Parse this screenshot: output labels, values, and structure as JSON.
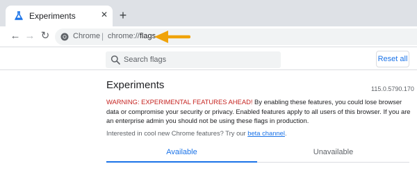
{
  "browser": {
    "tab": {
      "title": "Experiments",
      "close_glyph": "✕",
      "icon": "flask-icon"
    },
    "new_tab_glyph": "+",
    "nav": {
      "back_glyph": "←",
      "forward_glyph": "→",
      "reload_glyph": "↻"
    },
    "omnibox": {
      "chip": "Chrome",
      "separator": "|",
      "url_scheme": "chrome://",
      "url_path": "flags"
    },
    "annotation": {
      "icon": "orange-arrow-icon",
      "color": "#f0a30a"
    }
  },
  "page": {
    "search_placeholder": "Search flags",
    "reset_label": "Reset all",
    "title": "Experiments",
    "version": "115.0.5790.170",
    "warning_label": "WARNING: EXPERIMENTAL FEATURES AHEAD!",
    "warning_text": " By enabling these features, you could lose browser data or compromise your security or privacy. Enabled features apply to all users of this browser. If you are an enterprise admin you should not be using these flags in production.",
    "interest_text": "Interested in cool new Chrome features? Try our ",
    "beta_link": "beta channel",
    "interest_end": ".",
    "tabs": [
      {
        "label": "Available",
        "selected": true
      },
      {
        "label": "Unavailable",
        "selected": false
      }
    ]
  },
  "colors": {
    "accent": "#1a73e8",
    "warning": "#c5221f",
    "tabstrip": "#dee1e6"
  }
}
